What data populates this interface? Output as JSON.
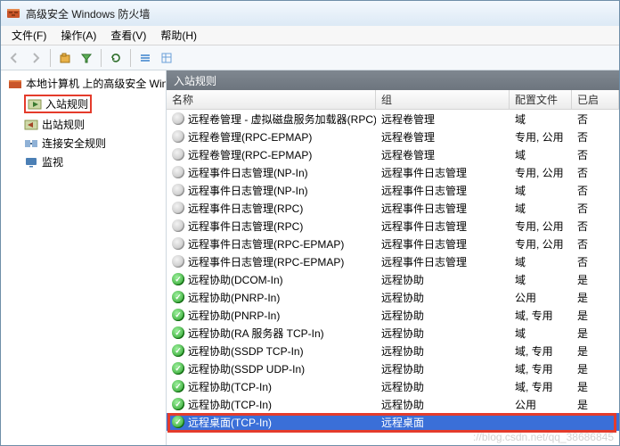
{
  "window": {
    "title": "高级安全 Windows 防火墙"
  },
  "menu": {
    "file": "文件(F)",
    "action": "操作(A)",
    "view": "查看(V)",
    "help": "帮助(H)"
  },
  "tree": {
    "root": "本地计算机 上的高级安全 Win",
    "inbound": "入站规则",
    "outbound": "出站规则",
    "connsec": "连接安全规则",
    "monitor": "监视"
  },
  "section": {
    "header": "入站规则"
  },
  "columns": {
    "name": "名称",
    "group": "组",
    "profile": "配置文件",
    "enabled": "已启"
  },
  "rules": [
    {
      "icon": "gray",
      "name": "远程卷管理 - 虚拟磁盘服务加载器(RPC)",
      "group": "远程卷管理",
      "profile": "域",
      "enabled": "否"
    },
    {
      "icon": "gray",
      "name": "远程卷管理(RPC-EPMAP)",
      "group": "远程卷管理",
      "profile": "专用, 公用",
      "enabled": "否"
    },
    {
      "icon": "gray",
      "name": "远程卷管理(RPC-EPMAP)",
      "group": "远程卷管理",
      "profile": "域",
      "enabled": "否"
    },
    {
      "icon": "gray",
      "name": "远程事件日志管理(NP-In)",
      "group": "远程事件日志管理",
      "profile": "专用, 公用",
      "enabled": "否"
    },
    {
      "icon": "gray",
      "name": "远程事件日志管理(NP-In)",
      "group": "远程事件日志管理",
      "profile": "域",
      "enabled": "否"
    },
    {
      "icon": "gray",
      "name": "远程事件日志管理(RPC)",
      "group": "远程事件日志管理",
      "profile": "域",
      "enabled": "否"
    },
    {
      "icon": "gray",
      "name": "远程事件日志管理(RPC)",
      "group": "远程事件日志管理",
      "profile": "专用, 公用",
      "enabled": "否"
    },
    {
      "icon": "gray",
      "name": "远程事件日志管理(RPC-EPMAP)",
      "group": "远程事件日志管理",
      "profile": "专用, 公用",
      "enabled": "否"
    },
    {
      "icon": "gray",
      "name": "远程事件日志管理(RPC-EPMAP)",
      "group": "远程事件日志管理",
      "profile": "域",
      "enabled": "否"
    },
    {
      "icon": "green",
      "name": "远程协助(DCOM-In)",
      "group": "远程协助",
      "profile": "域",
      "enabled": "是"
    },
    {
      "icon": "green",
      "name": "远程协助(PNRP-In)",
      "group": "远程协助",
      "profile": "公用",
      "enabled": "是"
    },
    {
      "icon": "green",
      "name": "远程协助(PNRP-In)",
      "group": "远程协助",
      "profile": "域, 专用",
      "enabled": "是"
    },
    {
      "icon": "green",
      "name": "远程协助(RA 服务器 TCP-In)",
      "group": "远程协助",
      "profile": "域",
      "enabled": "是"
    },
    {
      "icon": "green",
      "name": "远程协助(SSDP TCP-In)",
      "group": "远程协助",
      "profile": "域, 专用",
      "enabled": "是"
    },
    {
      "icon": "green",
      "name": "远程协助(SSDP UDP-In)",
      "group": "远程协助",
      "profile": "域, 专用",
      "enabled": "是"
    },
    {
      "icon": "green",
      "name": "远程协助(TCP-In)",
      "group": "远程协助",
      "profile": "域, 专用",
      "enabled": "是"
    },
    {
      "icon": "green",
      "name": "远程协助(TCP-In)",
      "group": "远程协助",
      "profile": "公用",
      "enabled": "是"
    },
    {
      "icon": "green",
      "name": "远程桌面(TCP-In)",
      "group": "远程桌面",
      "profile": "",
      "enabled": "",
      "selected": true
    }
  ],
  "watermark": "://blog.csdn.net/qq_38686845"
}
